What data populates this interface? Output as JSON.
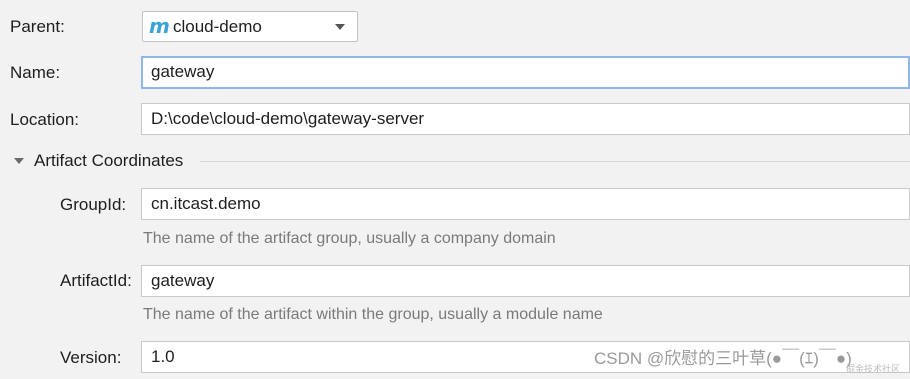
{
  "form": {
    "parent": {
      "label": "Parent:",
      "value": "cloud-demo",
      "icon": "maven-m-icon",
      "icon_glyph": "m"
    },
    "name": {
      "label": "Name:",
      "value": "gateway"
    },
    "location": {
      "label": "Location:",
      "value": "D:\\code\\cloud-demo\\gateway-server"
    }
  },
  "artifact_section": {
    "title": "Artifact Coordinates",
    "expanded": true,
    "group_id": {
      "label": "GroupId:",
      "value": "cn.itcast.demo",
      "hint": "The name of the artifact group, usually a company domain"
    },
    "artifact_id": {
      "label": "ArtifactId:",
      "value": "gateway",
      "hint": "The name of the artifact within the group, usually a module name"
    },
    "version": {
      "label": "Version:",
      "value": "1.0"
    }
  },
  "watermark": {
    "text": "CSDN @欣慰的三叶草(●￣(ｴ)￣●)",
    "small": "掘金技术社区"
  },
  "colors": {
    "focus_border": "#8fb7e8",
    "maven_icon": "#3aa3d8",
    "background": "#f2f2f2"
  }
}
